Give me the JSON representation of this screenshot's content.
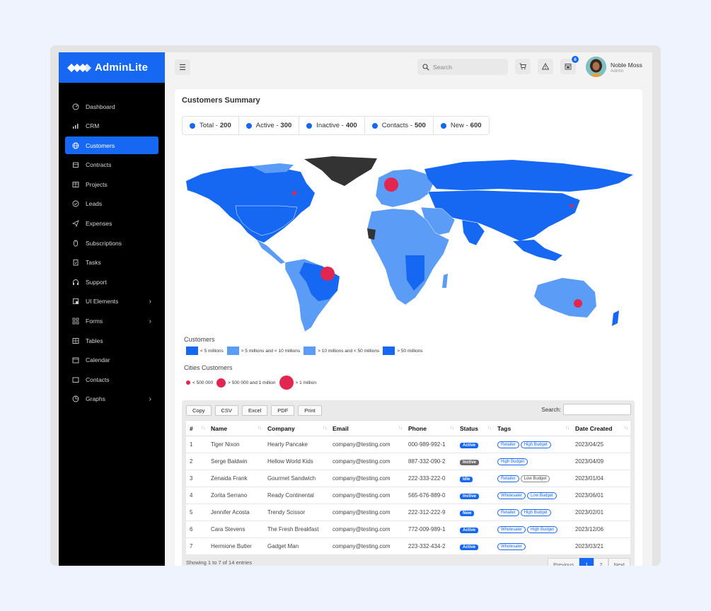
{
  "brand": {
    "name": "AdminLite",
    "color": "#1668f2"
  },
  "sidebar": {
    "items": [
      {
        "label": "Dashboard",
        "icon": "dashboard-icon",
        "chevron": false,
        "active": false
      },
      {
        "label": "CRM",
        "icon": "chart-icon",
        "chevron": false,
        "active": false
      },
      {
        "label": "Customers",
        "icon": "globe-icon",
        "chevron": false,
        "active": true
      },
      {
        "label": "Contracts",
        "icon": "contract-icon",
        "chevron": false,
        "active": false
      },
      {
        "label": "Projects",
        "icon": "projects-icon",
        "chevron": false,
        "active": false
      },
      {
        "label": "Leads",
        "icon": "leads-icon",
        "chevron": false,
        "active": false
      },
      {
        "label": "Expenses",
        "icon": "send-icon",
        "chevron": false,
        "active": false
      },
      {
        "label": "Subscriptions",
        "icon": "subscriptions-icon",
        "chevron": false,
        "active": false
      },
      {
        "label": "Tasks",
        "icon": "tasks-icon",
        "chevron": false,
        "active": false
      },
      {
        "label": "Support",
        "icon": "headset-icon",
        "chevron": false,
        "active": false
      },
      {
        "label": "UI Elements",
        "icon": "ui-elements-icon",
        "chevron": true,
        "active": false
      },
      {
        "label": "Forms",
        "icon": "forms-icon",
        "chevron": true,
        "active": false
      },
      {
        "label": "Tables",
        "icon": "tables-icon",
        "chevron": false,
        "active": false
      },
      {
        "label": "Calendar",
        "icon": "calendar-icon",
        "chevron": false,
        "active": false
      },
      {
        "label": "Contacts",
        "icon": "contacts-icon",
        "chevron": false,
        "active": false
      },
      {
        "label": "Graphs",
        "icon": "graphs-icon",
        "chevron": true,
        "active": false
      }
    ]
  },
  "topbar": {
    "search_placeholder": "Search",
    "notification_count": "6",
    "user_name": "Noble Moss",
    "user_role": "Admin"
  },
  "summary": {
    "title": "Customers Summary",
    "stats": [
      {
        "label": "Total -",
        "value": "200"
      },
      {
        "label": "Active -",
        "value": "300"
      },
      {
        "label": "Inactive -",
        "value": "400"
      },
      {
        "label": "Contacts -",
        "value": "500"
      },
      {
        "label": "New -",
        "value": "600"
      }
    ]
  },
  "legend": {
    "customers_title": "Customers",
    "customers": [
      {
        "label": "< 5 millions",
        "color": "#1668f2"
      },
      {
        "label": "> 5 millions and < 10 millions",
        "color": "#5b9cf6"
      },
      {
        "label": "> 10 millions and < 50 millions",
        "color": "#5b9cf6"
      },
      {
        "label": "> 50 millions",
        "color": "#1668f2"
      }
    ],
    "cities_title": "Cities Customers",
    "cities": [
      {
        "label": "< 500 000"
      },
      {
        "label": "> 500 000 and 1 million"
      },
      {
        "label": "> 1 million"
      }
    ]
  },
  "table": {
    "buttons": [
      "Copy",
      "CSV",
      "Excel",
      "PDF",
      "Print"
    ],
    "search_label": "Search:",
    "columns": [
      "#",
      "Name",
      "Company",
      "Email",
      "Phone",
      "Status",
      "Tags",
      "Date Created"
    ],
    "rows": [
      {
        "n": "1",
        "name": "Tiger Nixon",
        "company": "Hearty Pancake",
        "email": "company@testing.com",
        "phone": "000-989-992-1",
        "status": "Active",
        "tags": [
          "Retailer",
          "High Budget"
        ],
        "date": "2023/04/25"
      },
      {
        "n": "2",
        "name": "Serge Baldwin",
        "company": "Hellow World Kids",
        "email": "company@testing.com",
        "phone": "887-332-090-2",
        "status": "Inctive",
        "tags": [
          "High Budget"
        ],
        "date": "2023/04/09"
      },
      {
        "n": "3",
        "name": "Zenaida Frank",
        "company": "Gourmet Sandwich",
        "email": "company@testing.com",
        "phone": "222-333-222-0",
        "status": "Idle",
        "tags": [
          "Retailer",
          "Low Budget"
        ],
        "date": "2023/01/04"
      },
      {
        "n": "4",
        "name": "Zorita Serrano",
        "company": "Ready Continental",
        "email": "company@testing.com",
        "phone": "565-676-889-0",
        "status": "Inctive",
        "tags": [
          "Wholesaler",
          "Low Budget"
        ],
        "date": "2023/06/01"
      },
      {
        "n": "5",
        "name": "Jennifer Acosta",
        "company": "Trendy Scissor",
        "email": "company@testing.com",
        "phone": "222-312-222-9",
        "status": "New",
        "tags": [
          "Retailer",
          "High Budget"
        ],
        "date": "2023/02/01"
      },
      {
        "n": "6",
        "name": "Cara Stevens",
        "company": "The Fresh Breakfast",
        "email": "company@testing.com",
        "phone": "772-009-989-1",
        "status": "Active",
        "tags": [
          "Wholesaler",
          "High Budget"
        ],
        "date": "2023/12/06"
      },
      {
        "n": "7",
        "name": "Hermione Butler",
        "company": "Gadget Man",
        "email": "company@testing.com",
        "phone": "223-332-434-2",
        "status": "Active",
        "tags": [
          "Wholesaler"
        ],
        "date": "2023/03/21"
      }
    ],
    "footer": "Showing 1 to 7 of 14 entries",
    "pager": [
      "Previous",
      "1",
      "2",
      "Next"
    ]
  }
}
